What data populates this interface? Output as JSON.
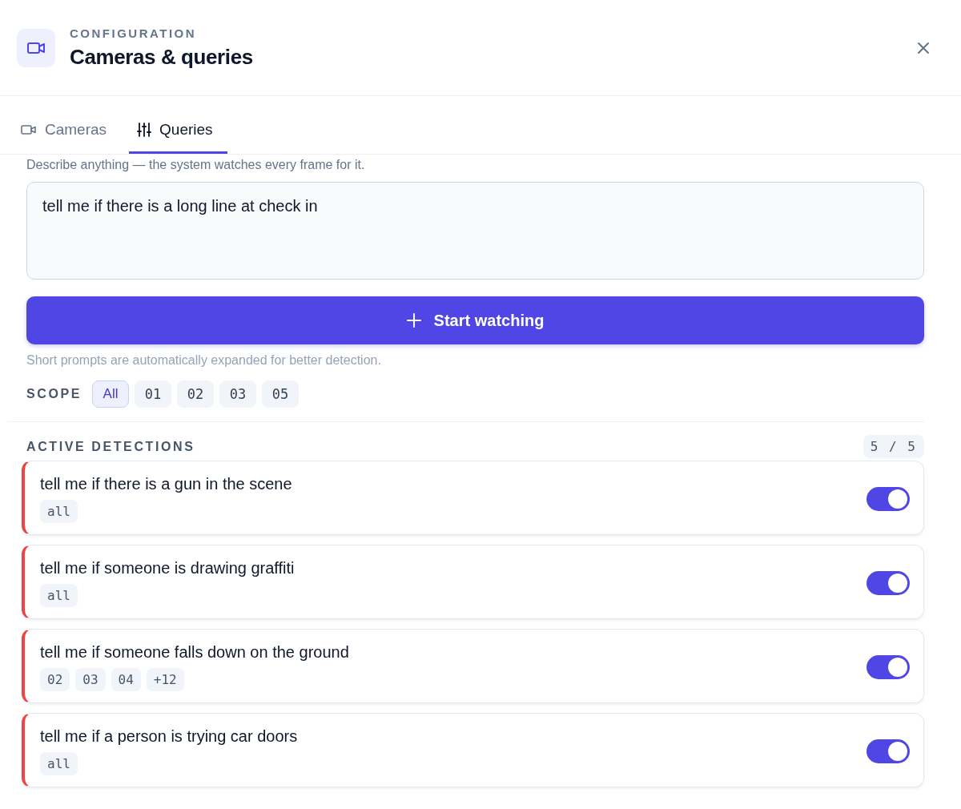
{
  "header": {
    "eyebrow": "CONFIGURATION",
    "title": "Cameras & queries"
  },
  "tabs": [
    {
      "label": "Cameras",
      "kind": "camera",
      "selected": false
    },
    {
      "label": "Queries",
      "kind": "sliders",
      "selected": true
    }
  ],
  "hint": "Describe anything — the system watches every frame for it.",
  "query_field": {
    "value": "tell me if there is a long line at check in"
  },
  "start_button": {
    "label": "Start watching"
  },
  "note": "Short prompts are automatically expanded for better detection.",
  "scope": {
    "label": "SCOPE",
    "options": [
      {
        "label": "All",
        "selected": true
      },
      {
        "label": "01",
        "selected": false
      },
      {
        "label": "02",
        "selected": false
      },
      {
        "label": "03",
        "selected": false
      },
      {
        "label": "05",
        "selected": false
      }
    ]
  },
  "detections": {
    "title": "ACTIVE DETECTIONS",
    "count": "5 / 5",
    "items": [
      {
        "text": "tell me if there is a gun in the scene",
        "tags": [
          "all"
        ],
        "on": true
      },
      {
        "text": "tell me if someone is drawing graffiti",
        "tags": [
          "all"
        ],
        "on": true
      },
      {
        "text": "tell me if someone falls down on the ground",
        "tags": [
          "02",
          "03",
          "04",
          "+12"
        ],
        "on": true
      },
      {
        "text": "tell me if a person is trying car doors",
        "tags": [
          "all"
        ],
        "on": true
      }
    ]
  }
}
